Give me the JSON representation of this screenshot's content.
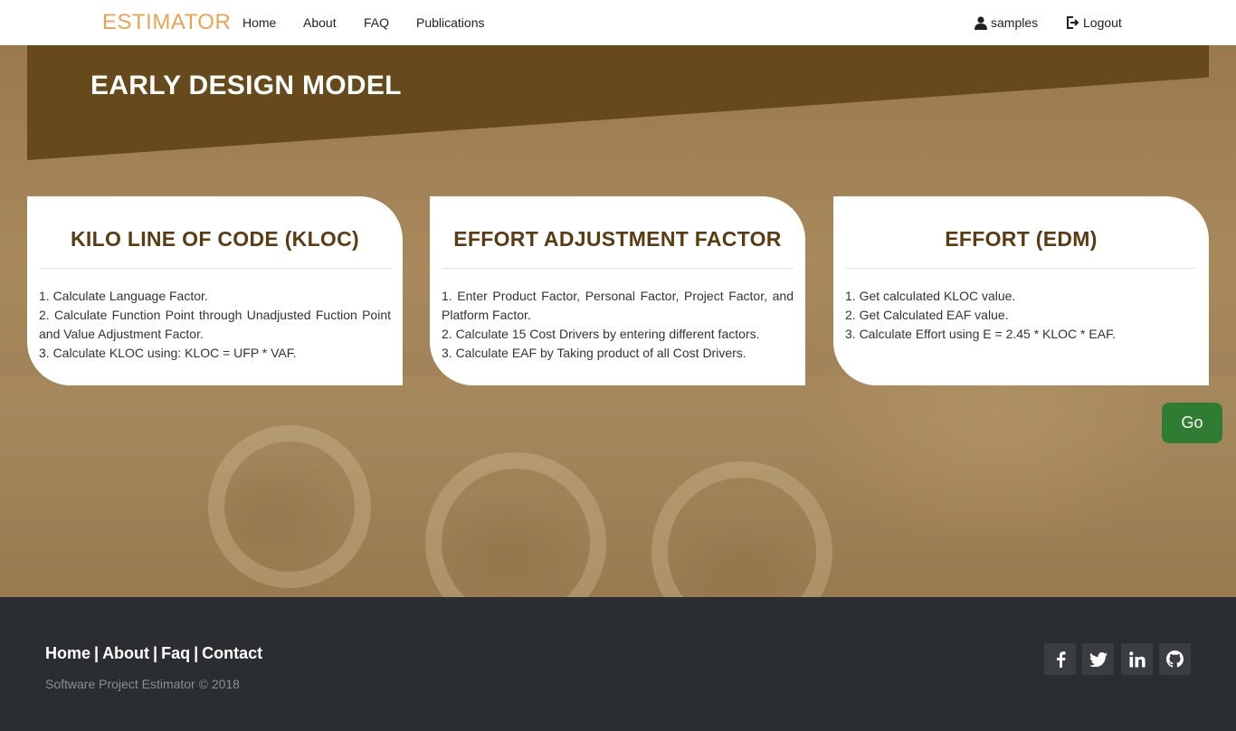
{
  "nav": {
    "brand": "ESTIMATOR",
    "links": [
      "Home",
      "About",
      "FAQ",
      "Publications"
    ],
    "user": "samples",
    "logout": "Logout",
    "user_icon": "user-icon",
    "logout_icon": "logout-icon"
  },
  "hero": {
    "title": "EARLY DESIGN MODEL",
    "banner_color": "#664a1b"
  },
  "cards": [
    {
      "title": "KILO LINE OF CODE (KLOC)",
      "items": [
        "1. Calculate Language Factor.",
        "2. Calculate Function Point through Unadjusted Fuction Point and Value Adjustment Factor.",
        "3. Calculate KLOC using: KLOC = UFP * VAF."
      ]
    },
    {
      "title": "EFFORT ADJUSTMENT FACTOR",
      "items": [
        "1. Enter Product Factor, Personal Factor, Project Factor, and Platform Factor.",
        "2. Calculate 15 Cost Drivers by entering different factors.",
        "3. Calculate EAF by Taking product of all Cost Drivers."
      ]
    },
    {
      "title": "EFFORT (EDM)",
      "items": [
        "1. Get calculated KLOC value.",
        "2. Get Calculated EAF value.",
        "3. Calculate Effort using E = 2.45 * KLOC * EAF."
      ]
    }
  ],
  "go_button": "Go",
  "footer": {
    "links": [
      "Home",
      "About",
      "Faq",
      "Contact"
    ],
    "separator": "|",
    "copyright": "Software Project Estimator © 2018",
    "social_icons": [
      "facebook-icon",
      "twitter-icon",
      "linkedin-icon",
      "github-icon"
    ]
  },
  "colors": {
    "brand": "#e8a452",
    "card_title": "#5a3c12",
    "go_button": "#2f7d32",
    "footer_bg": "#2a2d31"
  }
}
